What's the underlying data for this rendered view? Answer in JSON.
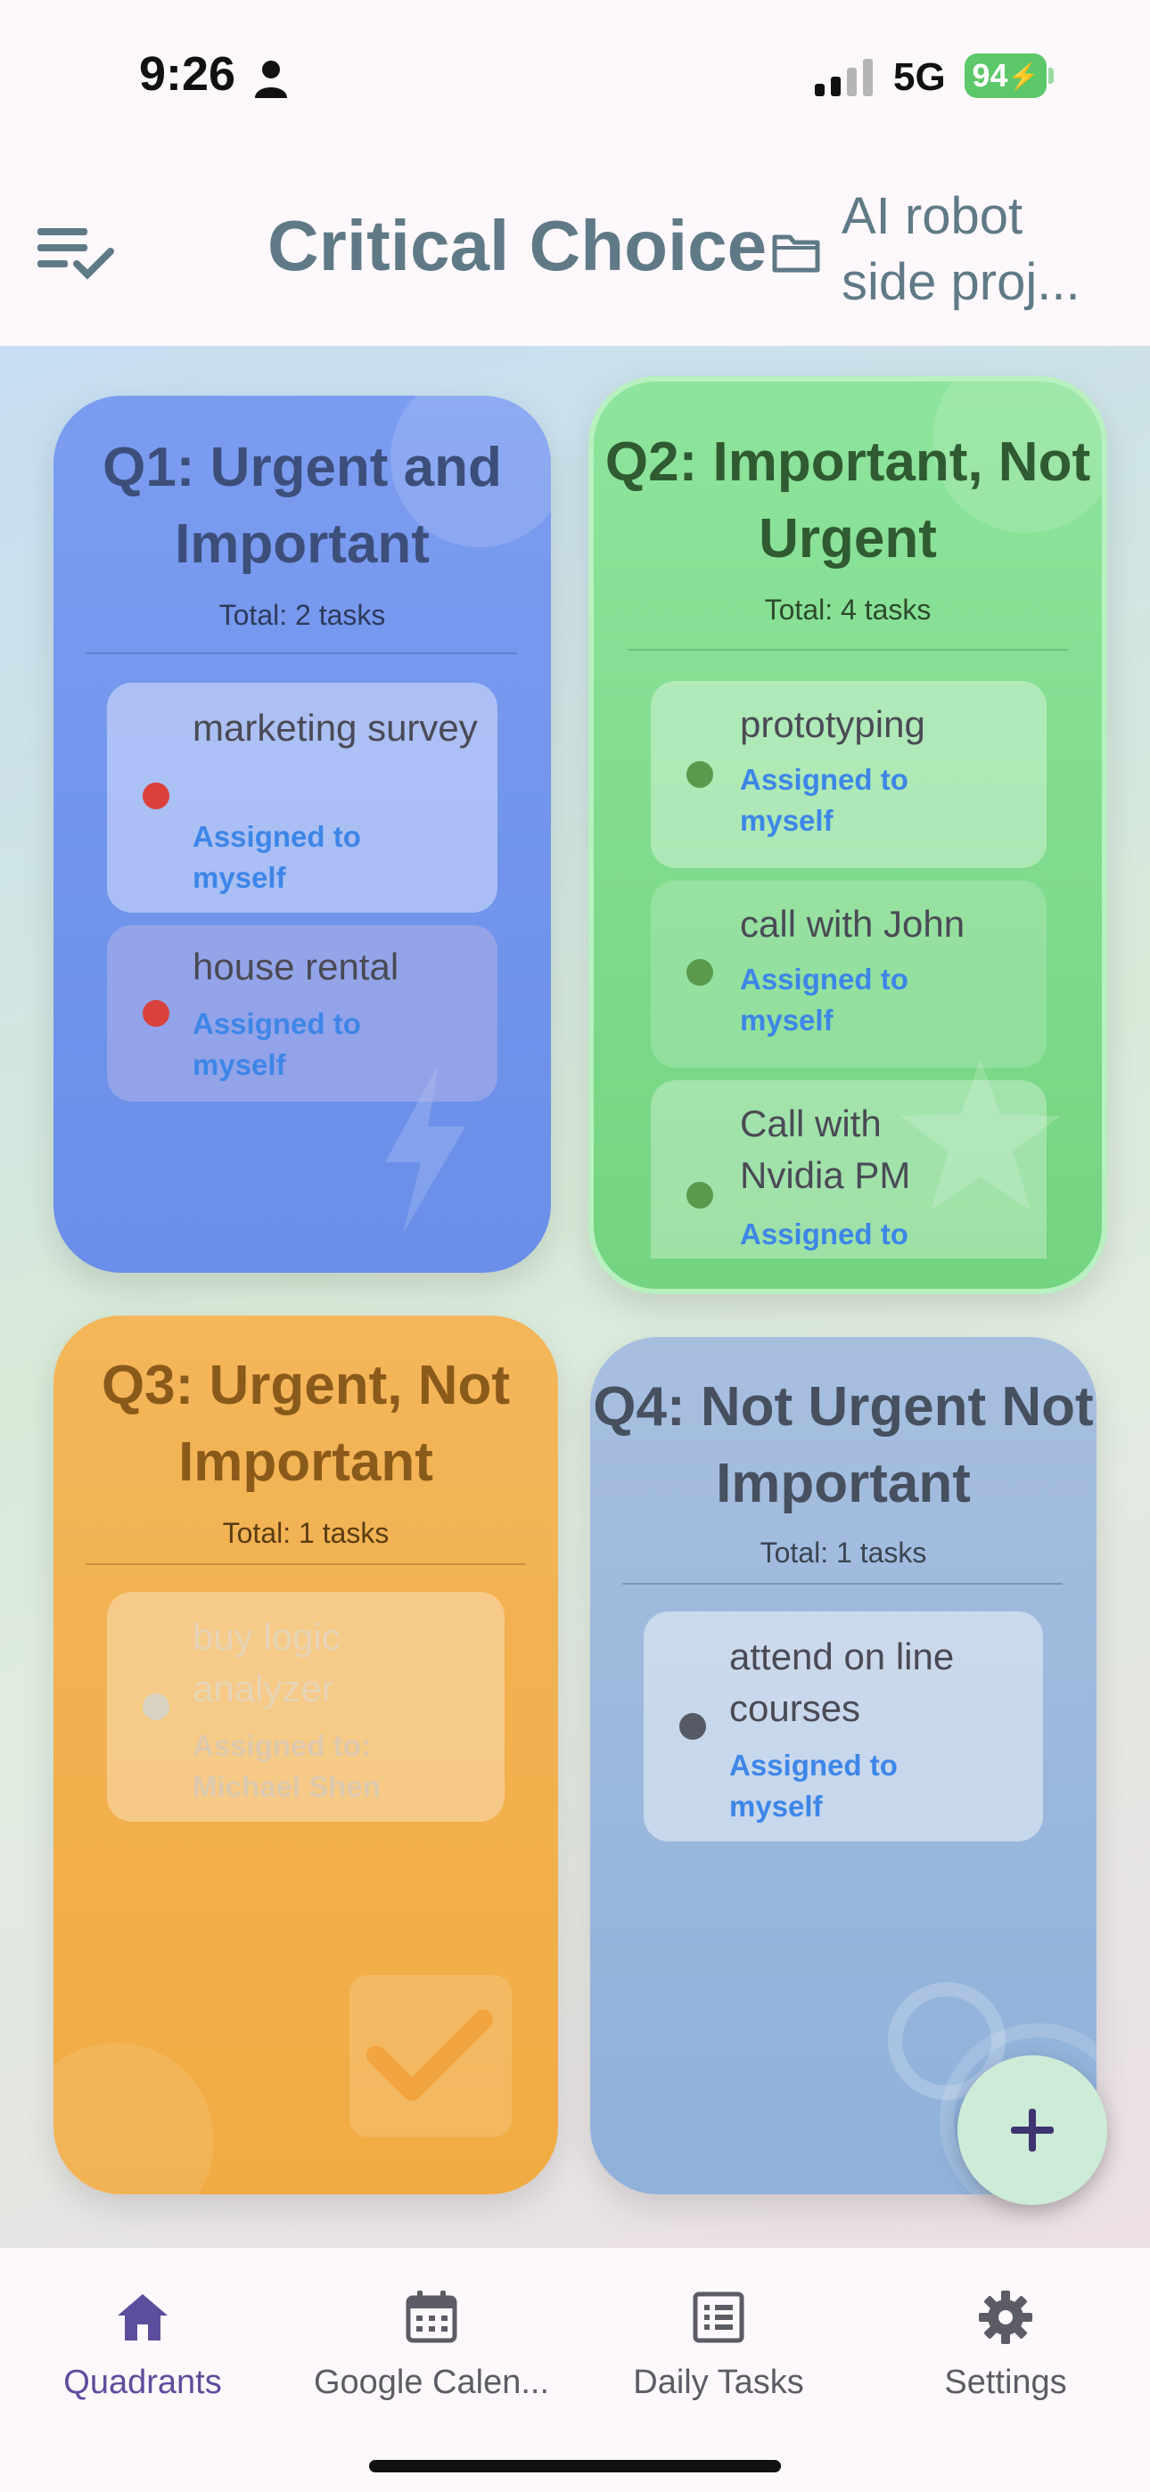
{
  "status_bar": {
    "time": "9:26",
    "network": "5G",
    "battery": "94"
  },
  "app_bar": {
    "title": "Critical Choice",
    "project": "AI robot side proj..."
  },
  "quadrants": [
    {
      "title": "Q1: Urgent and Important",
      "total": "Total: 2 tasks",
      "tasks": [
        {
          "name": "marketing survey",
          "assigned": "Assigned to myself"
        },
        {
          "name": "house rental",
          "assigned": "Assigned to myself"
        }
      ]
    },
    {
      "title": "Q2: Important, Not Urgent",
      "total": "Total: 4 tasks",
      "tasks": [
        {
          "name": "prototyping",
          "assigned": "Assigned to myself"
        },
        {
          "name": "call with John",
          "assigned": "Assigned to myself"
        },
        {
          "name": "Call with Nvidia PM",
          "assigned": "Assigned to"
        }
      ]
    },
    {
      "title": "Q3: Urgent, Not Important",
      "total": "Total: 1 tasks",
      "tasks": [
        {
          "name": "buy logic analyzer",
          "assigned": "Assigned to: Michael Shen"
        }
      ]
    },
    {
      "title": "Q4: Not Urgent Not Important",
      "total": "Total: 1 tasks",
      "tasks": [
        {
          "name": "attend on line courses",
          "assigned": "Assigned to myself"
        }
      ]
    }
  ],
  "fab": {
    "label": "+"
  },
  "bottom_nav": [
    {
      "label": "Quadrants",
      "icon": "home-icon",
      "active": true
    },
    {
      "label": "Google Calen...",
      "icon": "calendar-icon",
      "active": false
    },
    {
      "label": "Daily Tasks",
      "icon": "list-icon",
      "active": false
    },
    {
      "label": "Settings",
      "icon": "gear-icon",
      "active": false
    }
  ],
  "colors": {
    "q1": "#6f93ec",
    "q2": "#82dd90",
    "q3": "#f2b04c",
    "q4": "#9ab8dc",
    "dot_q1": "#d9413a",
    "dot_q2": "#5a9a4c",
    "dot_q3": "#d9d3c4",
    "dot_q4": "#555a66",
    "assign": "#3d86e8",
    "nav_active": "#5c4e9c"
  }
}
